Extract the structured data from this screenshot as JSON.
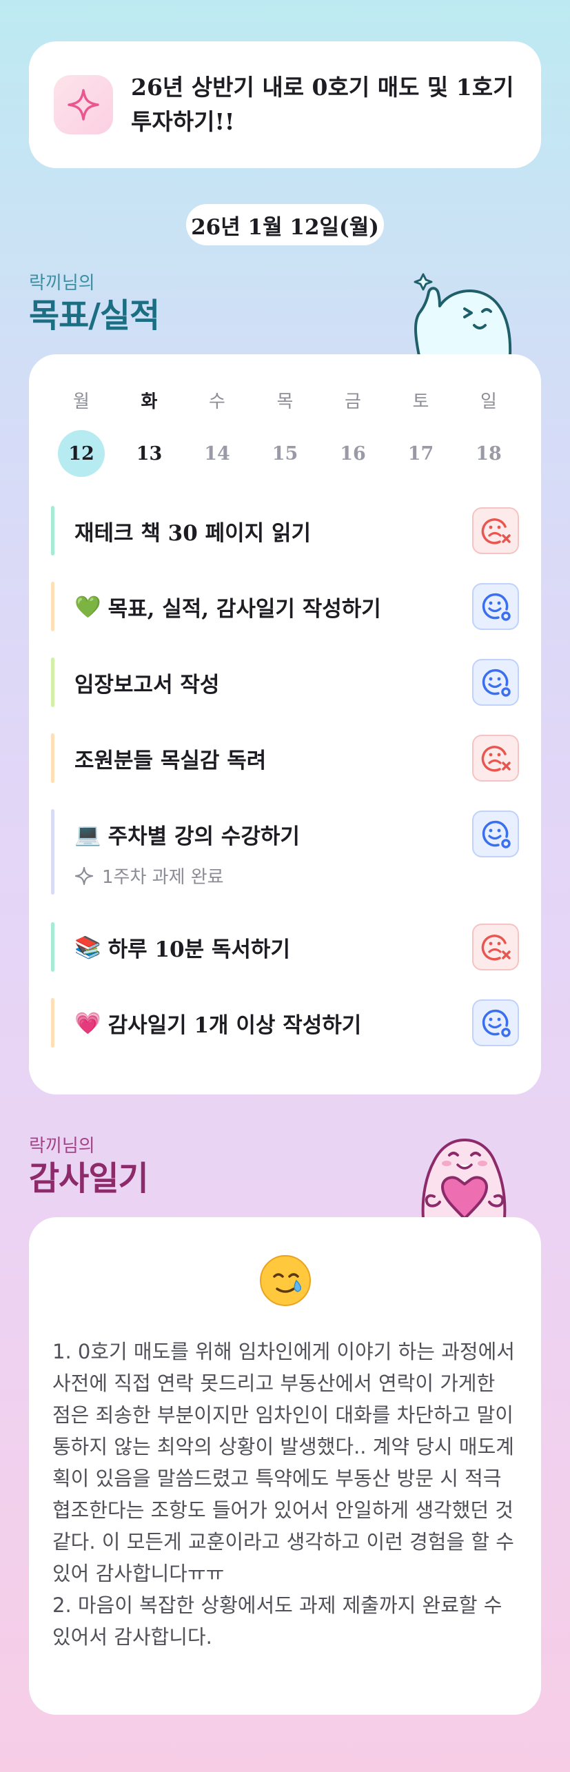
{
  "goal": {
    "icon": "sparkle-icon",
    "text": "26년 상반기 내로 0호기 매도 및 1호기 투자하기!!"
  },
  "date": "26년 1월 12일(월)",
  "goals_section": {
    "subtitle": "락끼님의",
    "title": "목표/실적",
    "weekdays": [
      "월",
      "화",
      "수",
      "목",
      "금",
      "토",
      "일"
    ],
    "days": [
      "12",
      "13",
      "14",
      "15",
      "16",
      "17",
      "18"
    ],
    "items": [
      {
        "emoji": "",
        "label": "재테크 책 30 페이지 읽기",
        "status": "fail",
        "bar_color": "#a6ecd4"
      },
      {
        "emoji": "💚",
        "label": "목표, 실적, 감사일기 작성하기",
        "status": "ok",
        "bar_color": "#fde0b8"
      },
      {
        "emoji": "",
        "label": "임장보고서 작성",
        "status": "ok",
        "bar_color": "#d2f0a8"
      },
      {
        "emoji": "",
        "label": "조원분들 목실감 독려",
        "status": "fail",
        "bar_color": "#fde0b8"
      },
      {
        "emoji": "💻",
        "label": "주차별 강의 수강하기",
        "status": "ok",
        "bar_color": "#d8dcf6",
        "sub": "1주차 과제 완료"
      },
      {
        "emoji": "📚",
        "label": "하루 10분 독서하기",
        "status": "fail",
        "bar_color": "#a6ecd4"
      },
      {
        "emoji": "💗",
        "label": "감사일기 1개 이상 작성하기",
        "status": "ok",
        "bar_color": "#fde0b8"
      }
    ],
    "colors": {
      "title": "#1c6f83",
      "subtitle": "#3c8ea2",
      "fail": "#e9554f",
      "ok": "#3a6ff0"
    }
  },
  "gratitude_section": {
    "subtitle": "락끼님의",
    "title": "감사일기",
    "emoji": "🥲",
    "text": "1. 0호기 매도를 위해 임차인에게 이야기 하는 과정에서 사전에 직접 연락 못드리고 부동산에서 연락이 가게한 점은 죄송한 부분이지만 임차인이 대화를 차단하고 말이 통하지 않는 최악의 상황이 발생했다.. 계약 당시 매도계획이 있음을 말씀드렸고 특약에도 부동산 방문 시 적극 협조한다는 조항도 들어가 있어서 안일하게 생각했던 것 같다. 이 모든게 교훈이라고 생각하고 이런 경험을 할 수 있어 감사합니다ㅠㅠ\n2. 마음이 복잡한 상황에서도 과제 제출까지 완료할 수 있어서 감사합니다.",
    "colors": {
      "title": "#8c2a6a",
      "subtitle": "#a24486"
    }
  }
}
